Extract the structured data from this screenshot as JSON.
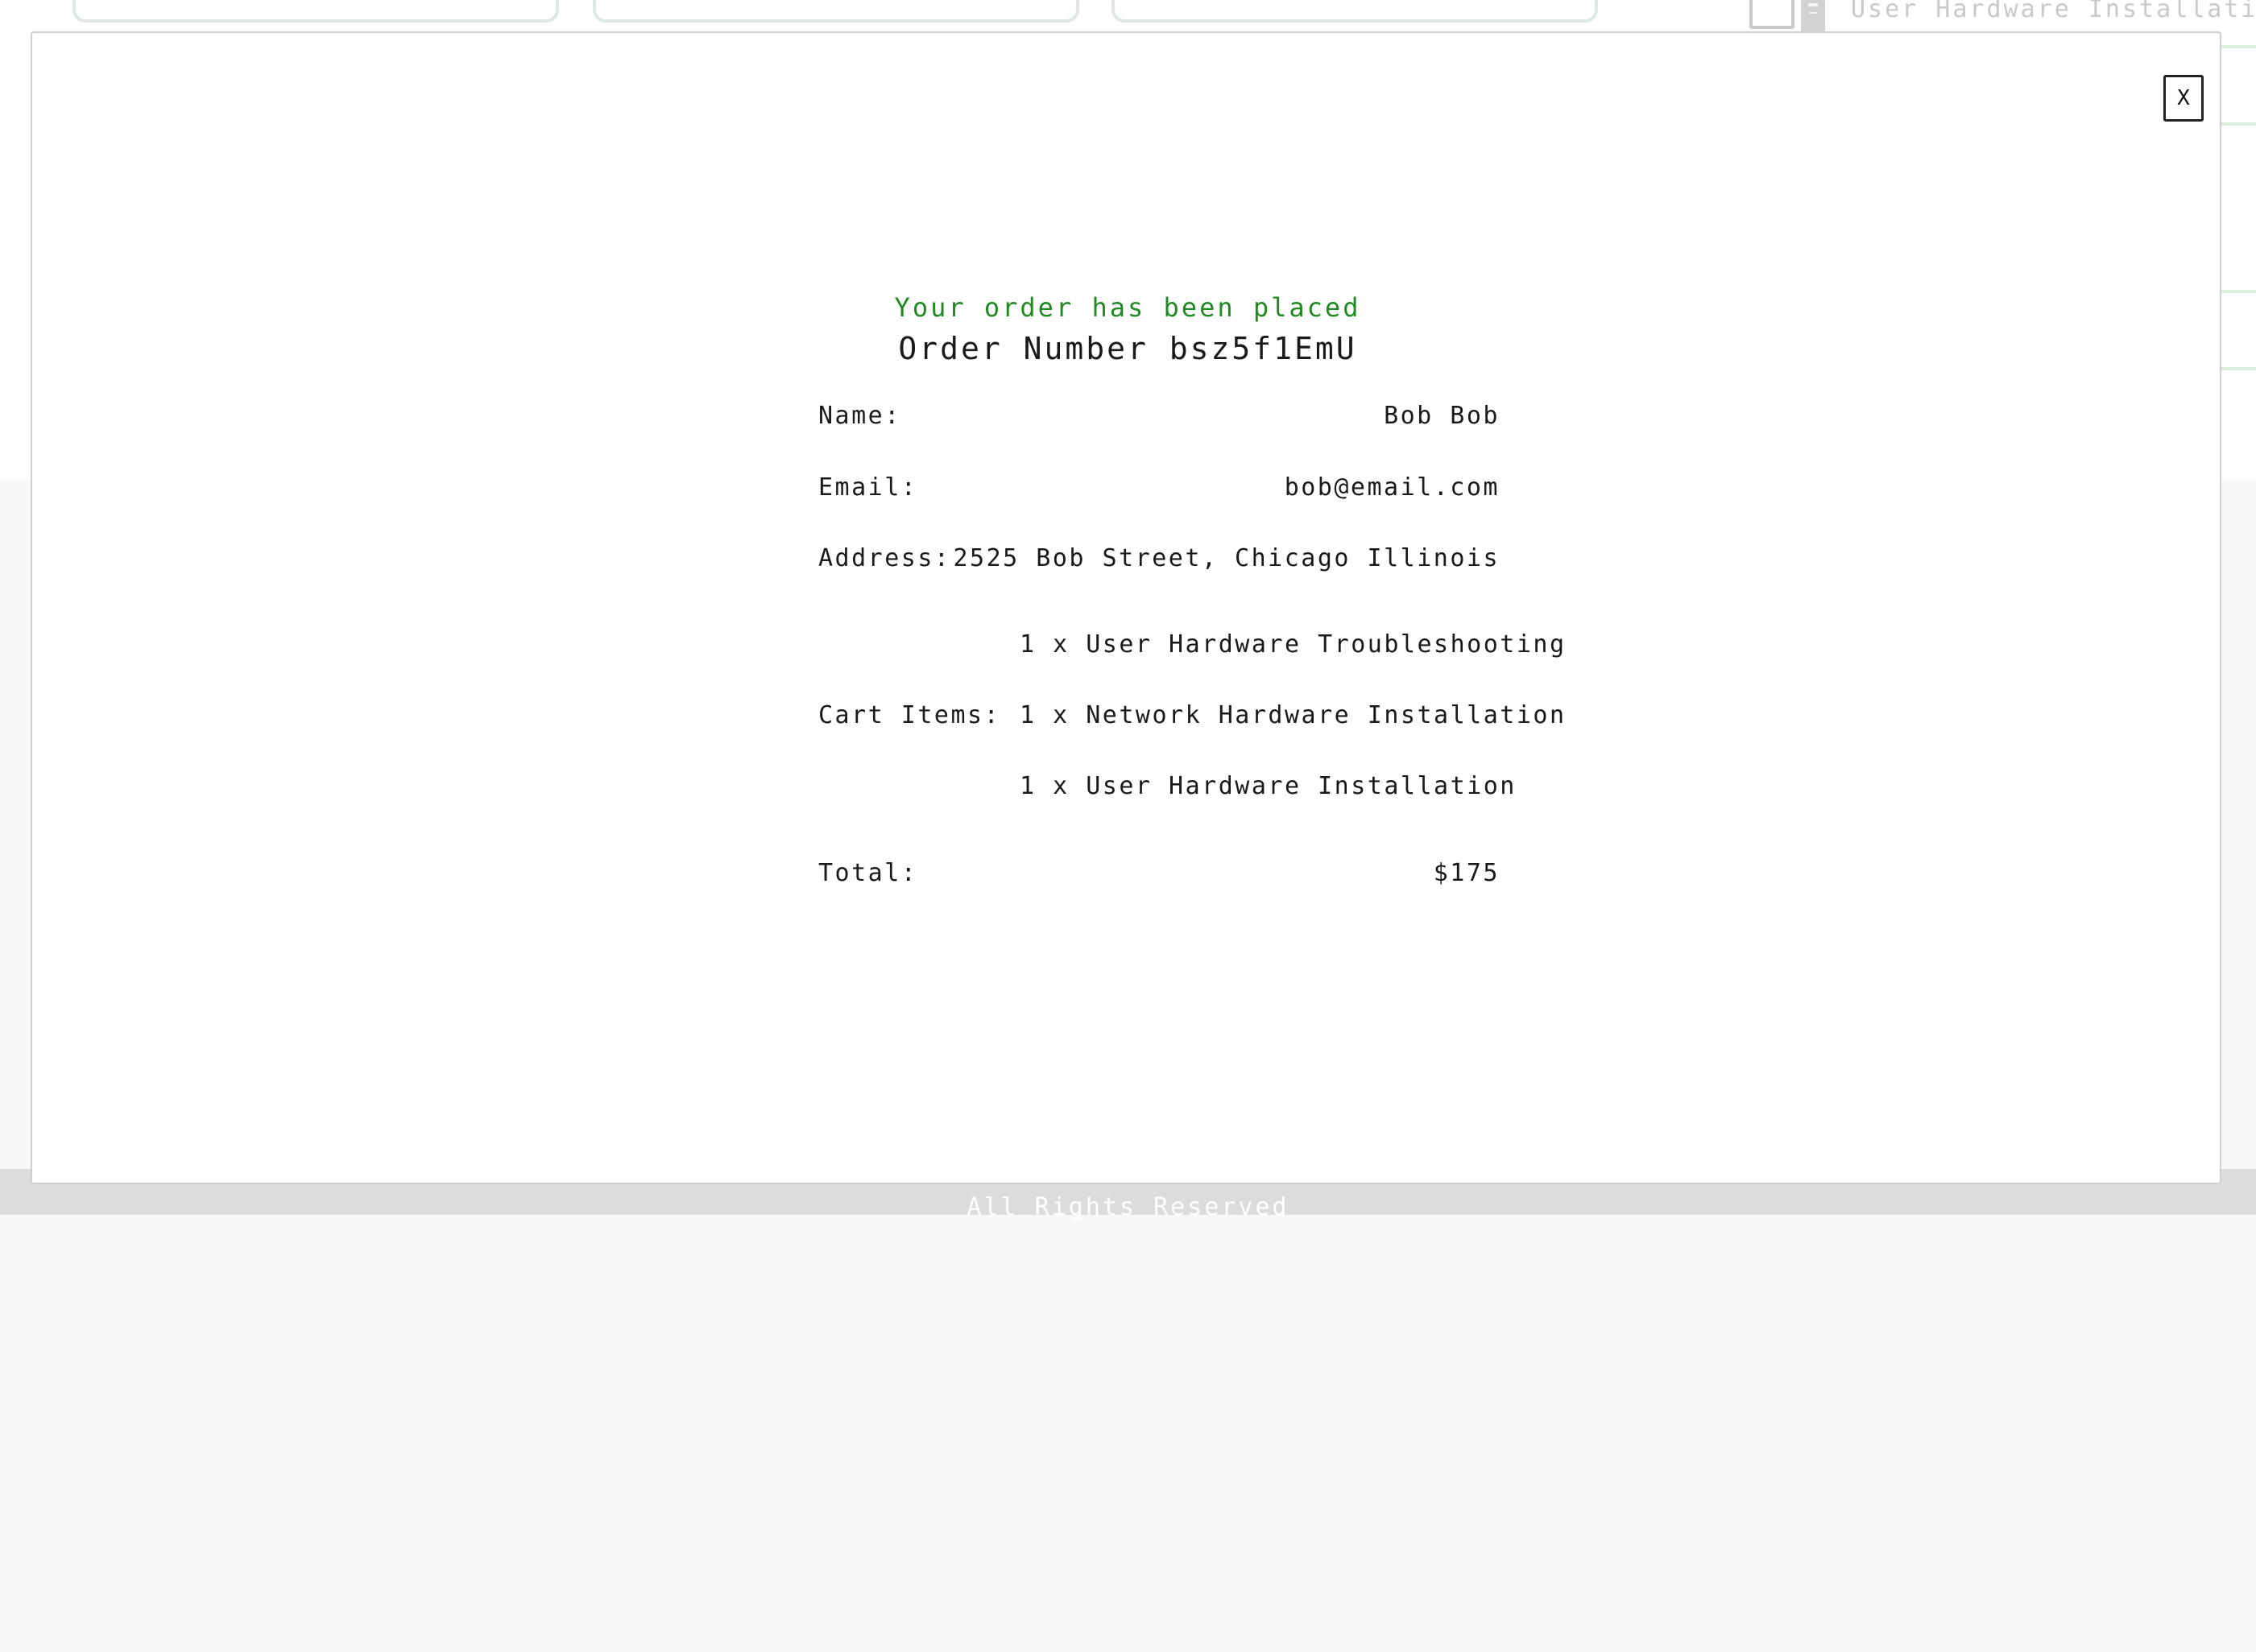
{
  "background": {
    "product_name": "User Hardware Installation",
    "footer_text": "All Rights Reserved"
  },
  "modal": {
    "close_label": "X",
    "status_message": "Your order has been placed",
    "order_number_label": "Order Number",
    "order_number": "bsz5f1EmU",
    "name_label": "Name:",
    "name_value": "Bob Bob",
    "email_label": "Email:",
    "email_value": "bob@email.com",
    "address_label": "Address:",
    "address_value": "2525 Bob Street, Chicago Illinois",
    "cart_label": "Cart Items:",
    "cart_items": [
      "1 x User Hardware Troubleshooting",
      "1 x Network Hardware Installation",
      "1 x User Hardware Installation"
    ],
    "total_label": "Total:",
    "total_value": "$175"
  },
  "colors": {
    "success_text": "#1f8a1f",
    "footer_background": "#dcdcdc",
    "card_border": "#dfe9e2"
  }
}
